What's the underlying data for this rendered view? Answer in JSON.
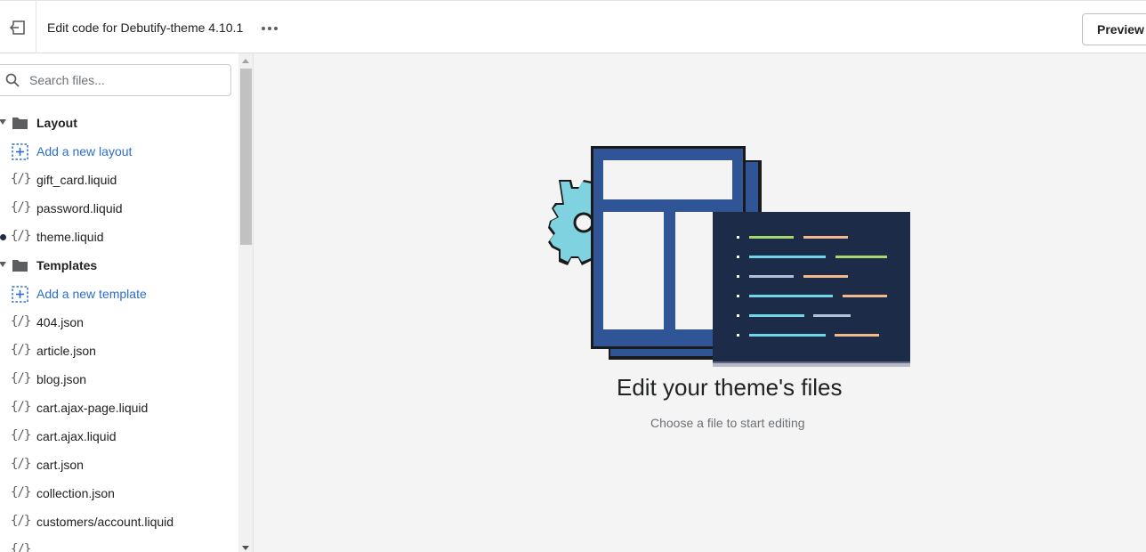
{
  "topbar": {
    "title": "Edit code for Debutify-theme 4.10.1",
    "preview_label": "Preview s",
    "exit_icon": "exit-icon",
    "more_icon": "more-horizontal-icon"
  },
  "sidebar": {
    "search_placeholder": "Search files...",
    "layout_section": {
      "label": "Layout",
      "add_label": "Add a new layout",
      "files": [
        "gift_card.liquid",
        "password.liquid",
        "theme.liquid"
      ]
    },
    "templates_section": {
      "label": "Templates",
      "add_label": "Add a new template",
      "files": [
        "404.json",
        "article.json",
        "blog.json",
        "cart.ajax-page.liquid",
        "cart.ajax.liquid",
        "cart.json",
        "collection.json",
        "customers/account.liquid"
      ]
    }
  },
  "main": {
    "empty_title": "Edit your theme's files",
    "empty_subtitle": "Choose a file to start editing"
  },
  "colors": {
    "link": "#2c6ecb",
    "illustration_blue": "#2f5597",
    "illustration_navy": "#1c2b47",
    "gear": "#7fd3e0"
  }
}
